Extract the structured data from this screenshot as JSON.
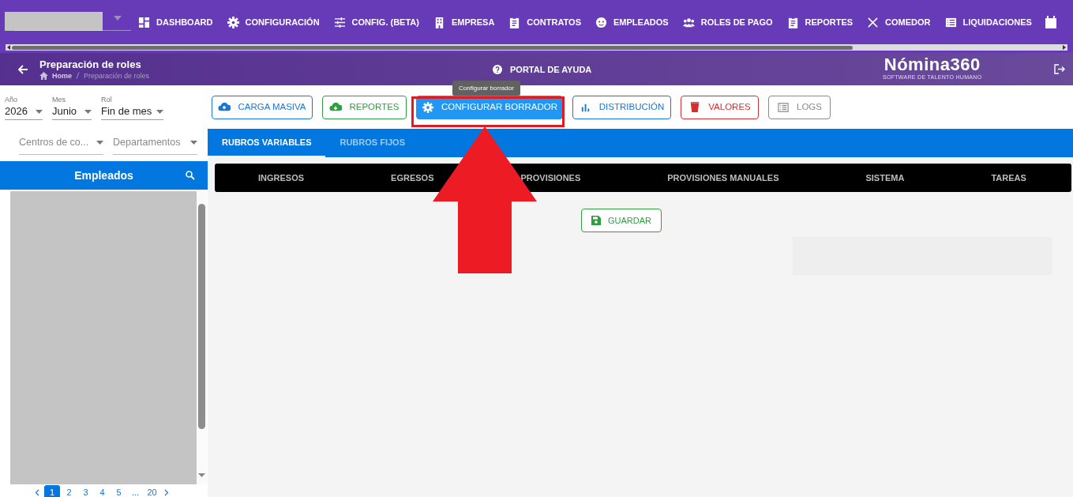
{
  "nav": {
    "items": [
      {
        "label": "DASHBOARD"
      },
      {
        "label": "CONFIGURACIÓN"
      },
      {
        "label": "CONFIG. (BETA)"
      },
      {
        "label": "EMPRESA"
      },
      {
        "label": "CONTRATOS"
      },
      {
        "label": "EMPLEADOS"
      },
      {
        "label": "ROLES DE PAGO"
      },
      {
        "label": "REPORTES"
      },
      {
        "label": "COMEDOR"
      },
      {
        "label": "LIQUIDACIONES"
      }
    ]
  },
  "header": {
    "title": "Preparación de roles",
    "breadcrumb": [
      {
        "label": "Home"
      },
      {
        "label": "Preparación de roles"
      }
    ],
    "help": "PORTAL DE AYUDA",
    "logo": "Nómina360",
    "logo_tagline": "SOFTWARE DE TALENTO HUMANO"
  },
  "filters": [
    {
      "label": "Año",
      "value": "2026"
    },
    {
      "label": "Mes",
      "value": "Junio"
    },
    {
      "label": "Rol",
      "value": "Fin de mes"
    }
  ],
  "filters2": [
    {
      "placeholder": "Centros de co..."
    },
    {
      "placeholder": "Departamentos"
    }
  ],
  "actions": [
    {
      "label": "CARGA MASIVA",
      "kind": "outlined",
      "color": "#1976d2"
    },
    {
      "label": "REPORTES",
      "kind": "outlined",
      "color": "#2e9e3e"
    },
    {
      "label": "CONFIGURAR BORRADOR",
      "kind": "filled",
      "color": "#2196f3"
    },
    {
      "label": "DISTRIBUCIÓN",
      "kind": "outlined",
      "color": "#1976d2"
    },
    {
      "label": "VALORES",
      "kind": "outlined",
      "color": "#d32f2f"
    },
    {
      "label": "LOGS",
      "kind": "outlined",
      "color": "#8a8a8a"
    }
  ],
  "tooltip": "Configurar borrador",
  "tabs": [
    {
      "label": "RUBROS VARIABLES",
      "selected": true
    },
    {
      "label": "RUBROS FIJOS",
      "selected": false
    }
  ],
  "subtabs": [
    {
      "label": "INGRESOS"
    },
    {
      "label": "EGRESOS"
    },
    {
      "label": "PROVISIONES"
    },
    {
      "label": "PROVISIONES MANUALES"
    },
    {
      "label": "SISTEMA"
    },
    {
      "label": "TAREAS"
    }
  ],
  "save_button": "GUARDAR",
  "employees": {
    "title": "Empleados",
    "pages": [
      {
        "label": "1",
        "selected": true
      },
      {
        "label": "2",
        "selected": false
      },
      {
        "label": "3",
        "selected": false
      },
      {
        "label": "4",
        "selected": false
      },
      {
        "label": "5",
        "selected": false
      },
      {
        "label": "...",
        "selected": false
      },
      {
        "label": "20",
        "selected": false
      }
    ]
  }
}
